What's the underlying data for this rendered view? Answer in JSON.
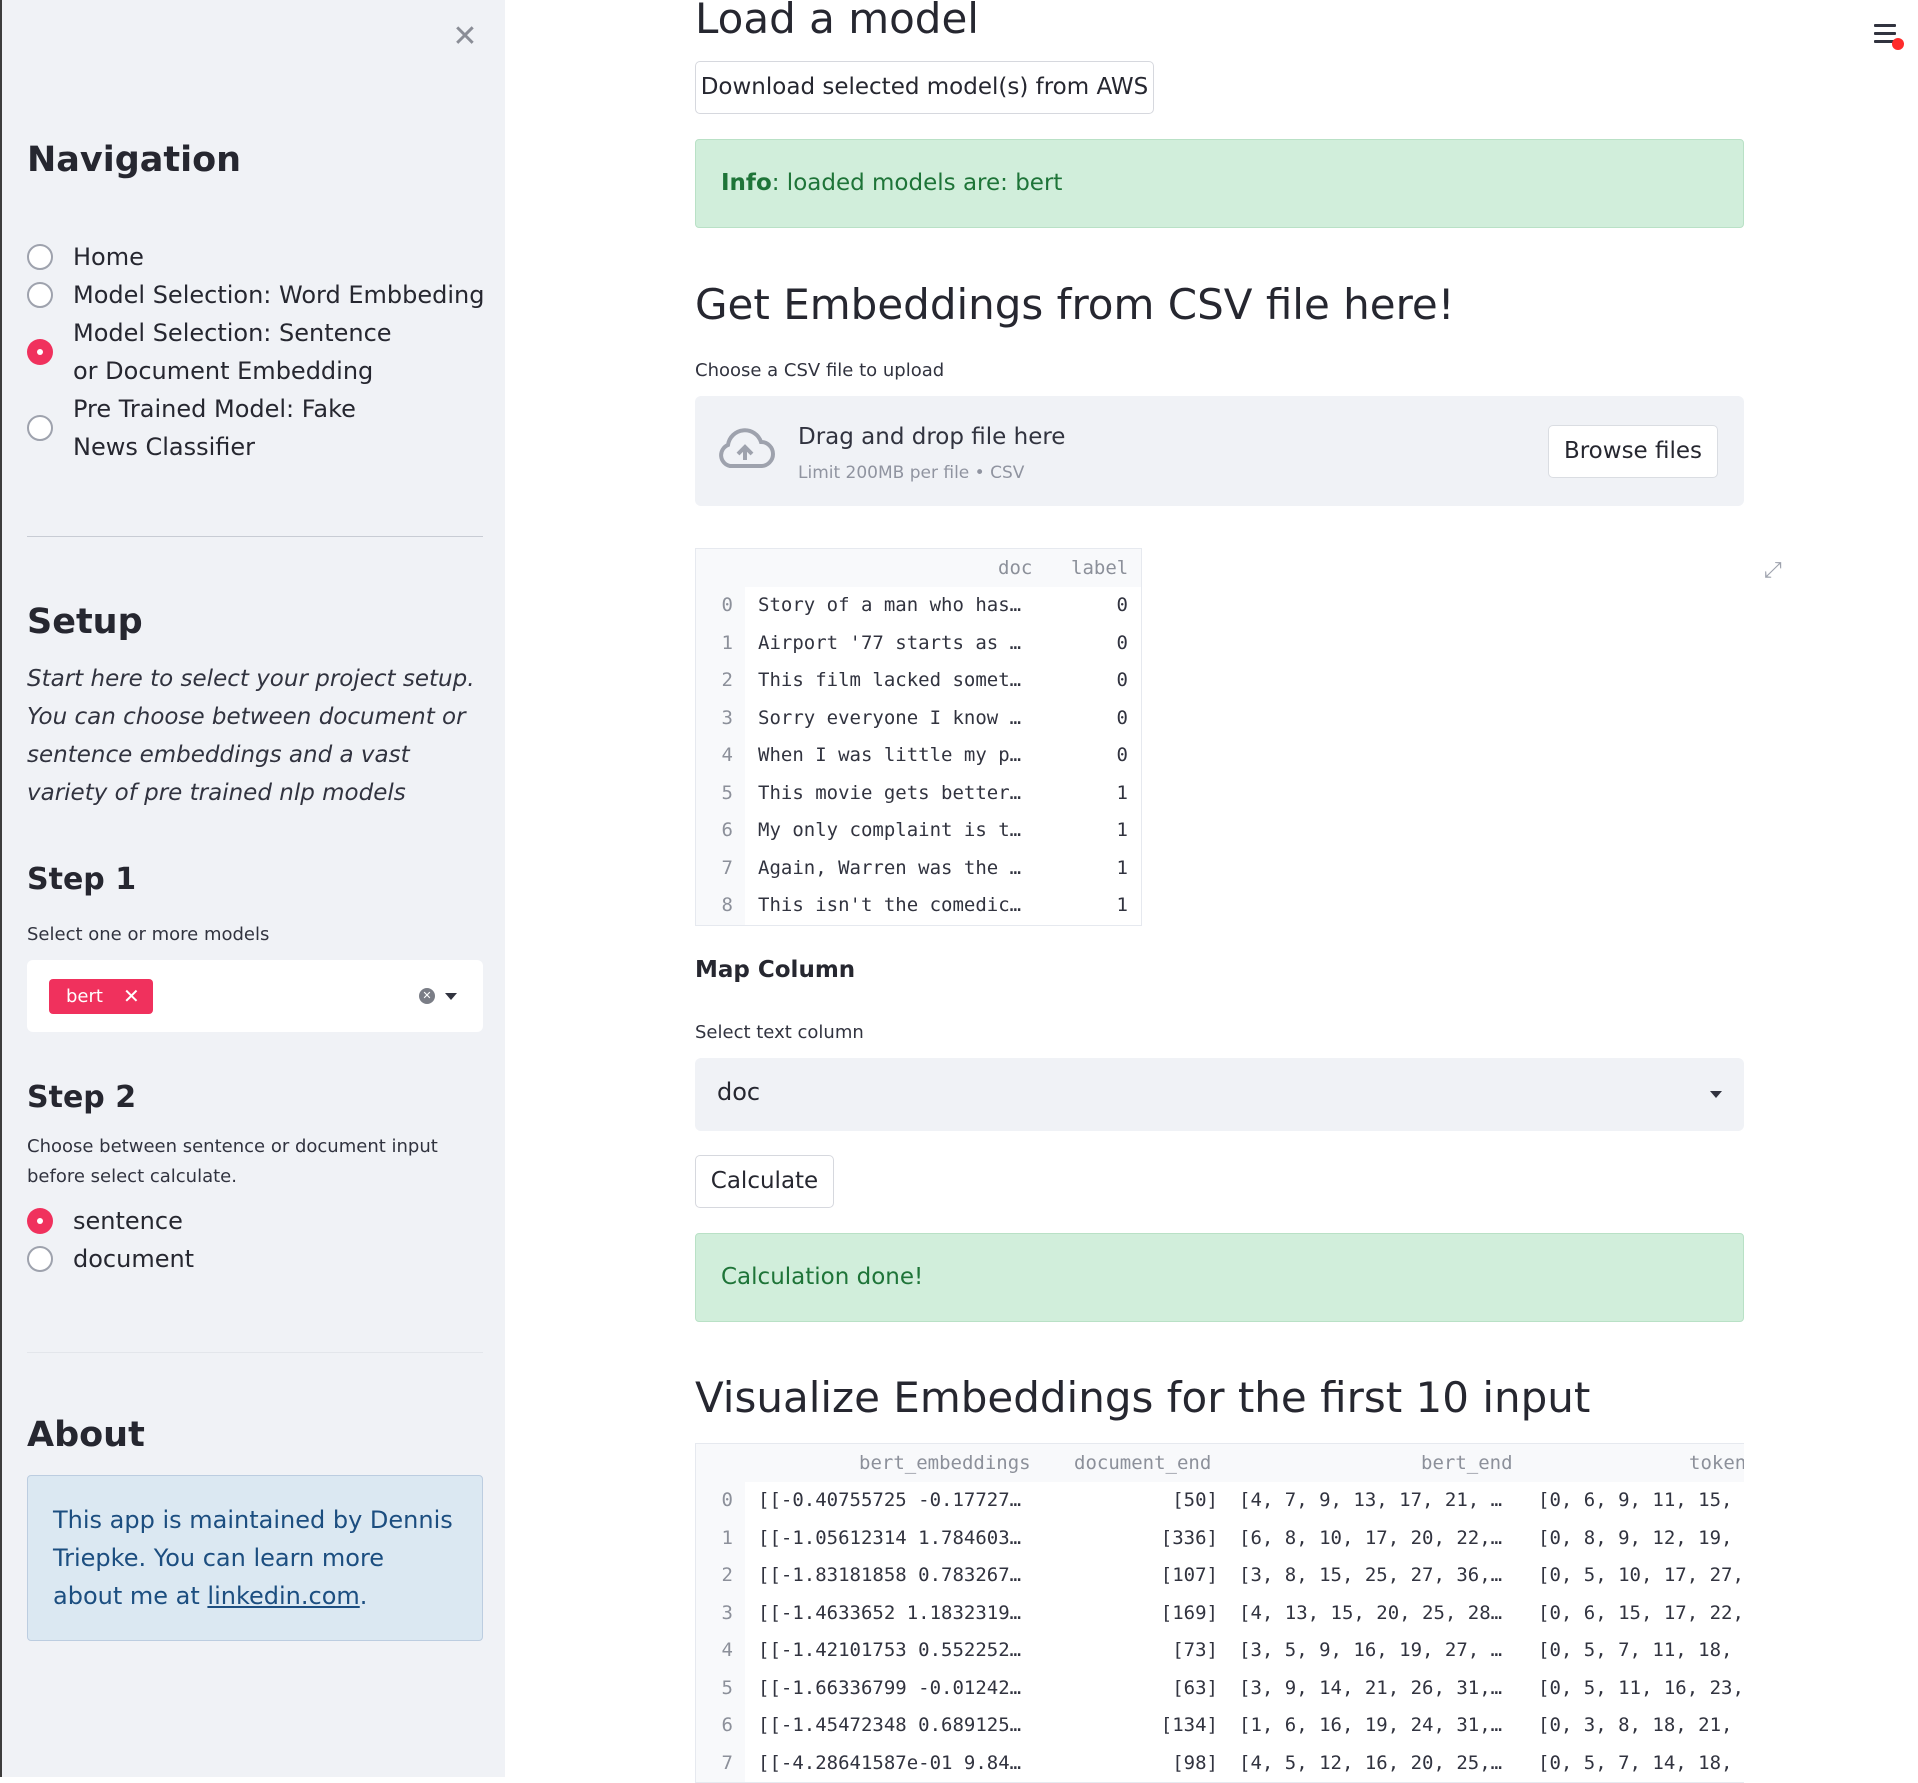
{
  "sidebar": {
    "close_icon": "close-icon",
    "navigation_title": "Navigation",
    "nav_items": [
      {
        "label": "Home",
        "checked": false
      },
      {
        "label": "Model Selection: Word Embbeding",
        "checked": false
      },
      {
        "label": "Model Selection: Sentence or Document Embedding",
        "checked": true
      },
      {
        "label": "Pre Trained Model: Fake News Classifier",
        "checked": false
      }
    ],
    "setup_title": "Setup",
    "setup_text": "Start here to select your project setup. You can choose between document or sentence embeddings and a vast variety of pre trained nlp models",
    "step1_title": "Step 1",
    "step1_label": "Select one or more models",
    "selected_models": [
      "bert"
    ],
    "step2_title": "Step 2",
    "step2_label": "Choose between sentence or document input before select calculate.",
    "input_options": [
      {
        "label": "sentence",
        "checked": true
      },
      {
        "label": "document",
        "checked": false
      }
    ],
    "about_title": "About",
    "about_text_1": "This app is maintained by Dennis Triepke. You can learn more about me at ",
    "about_link": "linkedin.com",
    "about_text_2": "."
  },
  "main": {
    "load_title": "Load a model",
    "download_button": "Download selected model(s) from AWS",
    "info_prefix": "Info",
    "info_text": ": loaded models are: bert",
    "csv_title": "Get Embeddings from CSV file here!",
    "upload_label": "Choose a CSV file to upload",
    "upload_title": "Drag and drop file here",
    "upload_limit": "Limit 200MB per file • CSV",
    "browse_button": "Browse files",
    "csv_table": {
      "columns": [
        "doc",
        "label"
      ],
      "rows": [
        {
          "idx": "0",
          "doc": "Story of a man who has…",
          "label": "0"
        },
        {
          "idx": "1",
          "doc": "Airport '77 starts as …",
          "label": "0"
        },
        {
          "idx": "2",
          "doc": "This film lacked somet…",
          "label": "0"
        },
        {
          "idx": "3",
          "doc": "Sorry everyone I know …",
          "label": "0"
        },
        {
          "idx": "4",
          "doc": "When I was little my p…",
          "label": "0"
        },
        {
          "idx": "5",
          "doc": "This movie gets better…",
          "label": "1"
        },
        {
          "idx": "6",
          "doc": "My only complaint is t…",
          "label": "1"
        },
        {
          "idx": "7",
          "doc": "Again, Warren was the …",
          "label": "1"
        },
        {
          "idx": "8",
          "doc": "This isn't the comedic…",
          "label": "1"
        }
      ]
    },
    "map_column_title": "Map Column",
    "select_text_label": "Select text column",
    "select_text_value": "doc",
    "calculate_button": "Calculate",
    "calc_done": "Calculation done!",
    "viz_title": "Visualize Embeddings for the first 10 input",
    "emb_table": {
      "columns": [
        "bert_embeddings",
        "document_end",
        "bert_end",
        "token"
      ],
      "rows": [
        {
          "idx": "0",
          "emb": "[[-0.40755725 -0.17727…",
          "doc_end": "[50]",
          "bert_end": "[4, 7, 9, 13, 17, 21, …",
          "token": "[0, 6, 9, 11, 15,"
        },
        {
          "idx": "1",
          "emb": "[[-1.05612314 1.784603…",
          "doc_end": "[336]",
          "bert_end": "[6, 8, 10, 17, 20, 22,…",
          "token": "[0, 8, 9, 12, 19,"
        },
        {
          "idx": "2",
          "emb": "[[-1.83181858 0.783267…",
          "doc_end": "[107]",
          "bert_end": "[3, 8, 15, 25, 27, 36,…",
          "token": "[0, 5, 10, 17, 27,"
        },
        {
          "idx": "3",
          "emb": "[[-1.4633652 1.1832319…",
          "doc_end": "[169]",
          "bert_end": "[4, 13, 15, 20, 25, 28…",
          "token": "[0, 6, 15, 17, 22,"
        },
        {
          "idx": "4",
          "emb": "[[-1.42101753 0.552252…",
          "doc_end": "[73]",
          "bert_end": "[3, 5, 9, 16, 19, 27, …",
          "token": "[0, 5, 7, 11, 18,"
        },
        {
          "idx": "5",
          "emb": "[[-1.66336799 -0.01242…",
          "doc_end": "[63]",
          "bert_end": "[3, 9, 14, 21, 26, 31,…",
          "token": "[0, 5, 11, 16, 23,"
        },
        {
          "idx": "6",
          "emb": "[[-1.45472348 0.689125…",
          "doc_end": "[134]",
          "bert_end": "[1, 6, 16, 19, 24, 31,…",
          "token": "[0, 3, 8, 18, 21,"
        },
        {
          "idx": "7",
          "emb": "[[-4.28641587e-01 9.84…",
          "doc_end": "[98]",
          "bert_end": "[4, 5, 12, 16, 20, 25,…",
          "token": "[0, 5, 7, 14, 18,"
        }
      ]
    }
  },
  "colors": {
    "accent": "#f0315d",
    "sidebar_bg": "#f0f2f6",
    "success_bg": "#d1eedb",
    "success_text": "#1e7438",
    "info_bg": "#dbe8f2"
  }
}
